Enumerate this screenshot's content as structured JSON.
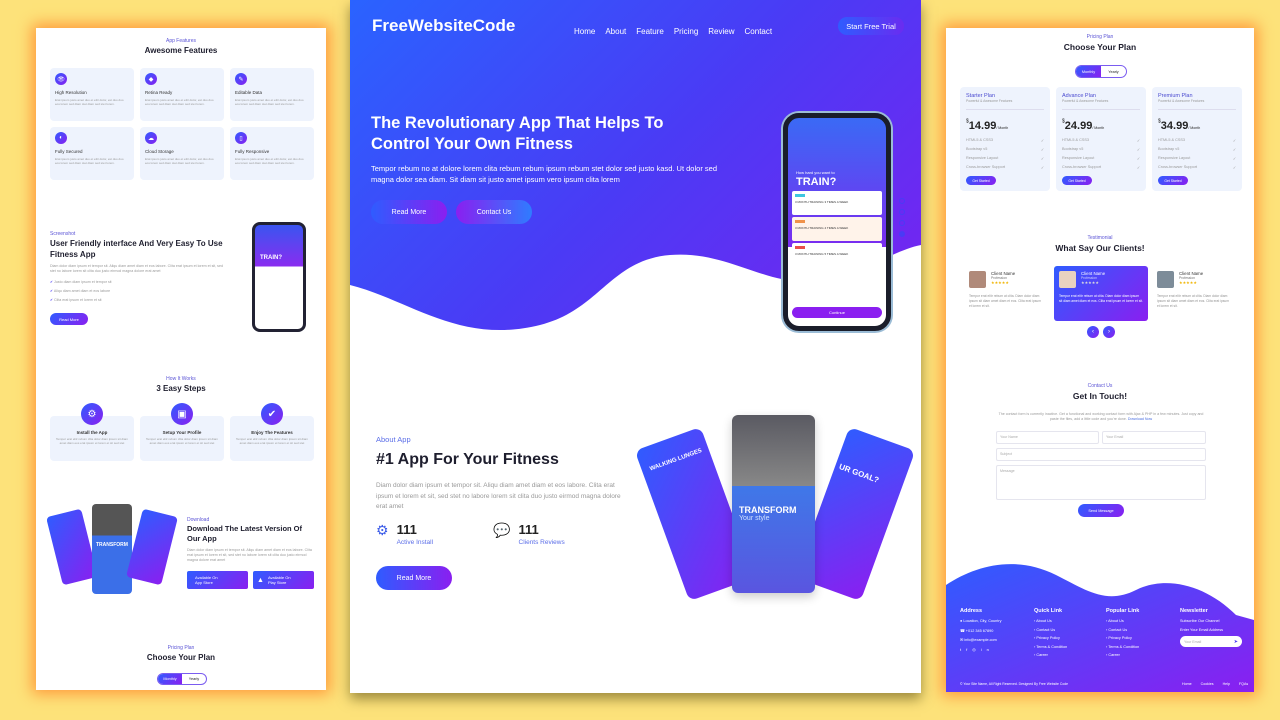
{
  "center": {
    "logo": "FreeWebsiteCode",
    "nav": [
      "Home",
      "About",
      "Feature",
      "Pricing",
      "Review",
      "Contact"
    ],
    "cta": "Start Free Trial",
    "hero": {
      "title_line1": "The Revolutionary App That Helps To",
      "title_line2": "Control Your Own Fitness",
      "text": "Tempor rebum no at dolore lorem clita rebum rebum ipsum rebum stet dolor sed justo kasd. Ut dolor sed magna dolor sea diam. Sit diam sit justo amet ipsum vero ipsum clita lorem",
      "read_more": "Read More",
      "contact": "Contact Us"
    },
    "phone": {
      "question": "How hard you want to",
      "title": "TRAIN?",
      "options": [
        "3 MONTH TRAINING 3 TIMES A WEEK",
        "3 MONTH TRAINING 4 TIMES A WEEK",
        "3 MONTH TRAINING 5 TIMES A WEEK"
      ],
      "continue": "Continue"
    },
    "about": {
      "label": "About App",
      "title": "#1 App For Your Fitness",
      "text": "Diam dolor diam ipsum et tempor sit. Aliqu diam amet diam et eos labore. Clita erat ipsum et lorem et sit, sed stet no labore lorem sit clita duo justo eirmod magna dolore erat amet",
      "stats": [
        {
          "value": "111",
          "label": "Active Install",
          "icon": "gears-icon"
        },
        {
          "value": "111",
          "label": "Clients Reviews",
          "icon": "comments-icon"
        }
      ],
      "read_more": "Read More"
    },
    "screens": {
      "left": "WALKING LUNGES",
      "mid_title": "TRANSFORM",
      "mid_sub": "Your style",
      "right": "UR GOAL?"
    }
  },
  "left": {
    "features": {
      "label": "App Features",
      "title": "Awesome Features",
      "items": [
        "High Resolution",
        "Retina Ready",
        "Editable Data",
        "Fully Secured",
        "Cloud Storage",
        "Fully Responsive"
      ],
      "desc": "Erat ipsum justo amet duo et elitr dolor, est duo duo eos lorem sed diam stet diam sed stet lorem."
    },
    "screenshot": {
      "label": "Screenshot",
      "title": "User Friendly interface And Very Easy To Use Fitness App",
      "text": "Diam dolor diam ipsum et tempor sit. Aliqu diam amet diam et eos labore. Clita erat ipsum et lorem et sit, sed stet no labore lorem sit clita duo justo eirmod magna dolore erat amet",
      "checks": [
        "Justo diam diam ipsum et tempor sit",
        "Aliqu diam amet diam et eos labore",
        "Clita erat ipsum et lorem et sit"
      ],
      "button": "Read More"
    },
    "steps": {
      "label": "How It Works",
      "title": "3 Easy Steps",
      "items": [
        "Install the App",
        "Setup Your Profile",
        "Enjoy The Features"
      ],
      "desc": "Tempor erat elitr rebum clita dolor diam ipsum sit diam amet diam eos erat ipsum et lorem et sit sed stet"
    },
    "download": {
      "label": "Download",
      "title": "Download The Latest Version Of Our App",
      "text": "Diam dolor diam ipsum et tempor sit. Aliqu diam amet diam et eos labore. Clita erat ipsum et lorem et sit, sed stet no labore lorem sit clita duo justo eirmod magna dolore erat amet",
      "stores": [
        {
          "small": "Available On",
          "big": "App Store"
        },
        {
          "small": "Available On",
          "big": "Play Store"
        }
      ]
    },
    "pricing": {
      "label": "Pricing Plan",
      "title": "Choose Your Plan",
      "monthly": "Monthly",
      "yearly": "Yearly"
    }
  },
  "right": {
    "pricing": {
      "label": "Pricing Plan",
      "title": "Choose Your Plan",
      "monthly": "Monthly",
      "yearly": "Yearly",
      "plans": [
        {
          "name": "Starter Plan",
          "price": "14.99"
        },
        {
          "name": "Advance Plan",
          "price": "24.99"
        },
        {
          "name": "Premium Plan",
          "price": "34.99"
        }
      ],
      "tagline": "Powerful & Awesome Features",
      "currency": "$",
      "per": "/ Month",
      "features": [
        "HTML5 & CSS3",
        "Bootstrap v5",
        "Responsive Layout",
        "Cross-browser Support"
      ],
      "button": "Get Started"
    },
    "testimonial": {
      "label": "Testimonial",
      "title": "What Say Our Clients!",
      "client": "Client Name",
      "profession": "Profession",
      "stars": "★★★★★",
      "text": "Tempor erat elitr rebum at clita. Diam dolor diam ipsum sit diam amet diam et eos. Clita erat ipsum et lorem et sit."
    },
    "contact": {
      "label": "Contact Us",
      "title": "Get In Touch!",
      "text": "The contact form is currently inactive. Get a functional and working contact form with Ajax & PHP in a few minutes. Just copy and paste the files, add a little code and you're done.",
      "link": "Download Now",
      "name": "Your Name",
      "email": "Your Email",
      "subject": "Subject",
      "message": "Message",
      "send": "Send Message"
    },
    "footer": {
      "address_title": "Address",
      "address": [
        "Location, City, Country",
        "+012 345 67890",
        "info@example.com"
      ],
      "quick_title": "Quick Link",
      "popular_title": "Popular Link",
      "links": [
        "About Us",
        "Contact Us",
        "Privacy Policy",
        "Terms & Condition",
        "Career"
      ],
      "newsletter_title": "Newsletter",
      "newsletter": [
        "Subscribe Our Channel",
        "Enter Your Email Address"
      ],
      "email_placeholder": "Your Email",
      "copyright": "© Your Site Name, All Right Reserved. Designed By Free Website Code",
      "bottom_links": [
        "Home",
        "Cookies",
        "Help",
        "FQAs"
      ]
    }
  },
  "colors": {
    "gradient_start": "#2f5cff",
    "gradient_end": "#8a1ff0",
    "background": "#fde27a",
    "glow": "#ff9a3c"
  }
}
